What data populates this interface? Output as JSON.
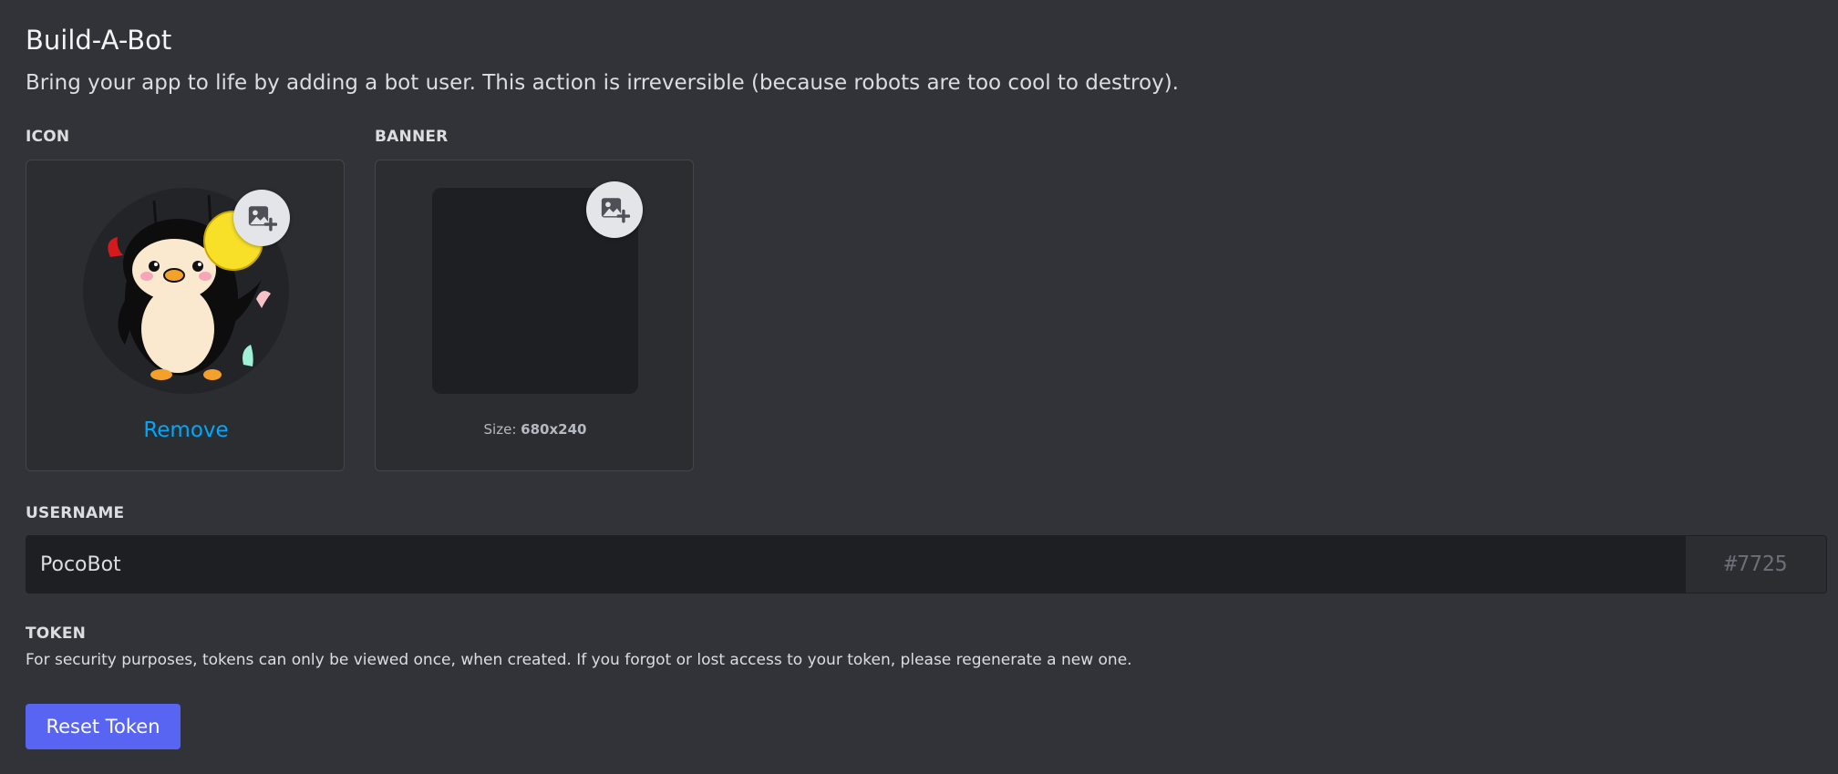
{
  "header": {
    "title": "Build-A-Bot",
    "subtitle": "Bring your app to life by adding a bot user. This action is irreversible (because robots are too cool to destroy)."
  },
  "icon_section": {
    "label": "ICON",
    "remove_label": "Remove",
    "upload_icon": "image-plus-icon",
    "avatar_description": "penguin-avatar"
  },
  "banner_section": {
    "label": "BANNER",
    "size_prefix": "Size: ",
    "size_value": "680x240",
    "upload_icon": "image-plus-icon"
  },
  "username_section": {
    "label": "USERNAME",
    "value": "PocoBot",
    "discriminator": "#7725"
  },
  "token_section": {
    "label": "TOKEN",
    "description": "For security purposes, tokens can only be viewed once, when created. If you forgot or lost access to your token, please regenerate a new one.",
    "reset_label": "Reset Token"
  },
  "colors": {
    "background": "#313338",
    "card": "#2b2d31",
    "input": "#1e1f22",
    "accent": "#5865f2",
    "link": "#00a8fc"
  }
}
